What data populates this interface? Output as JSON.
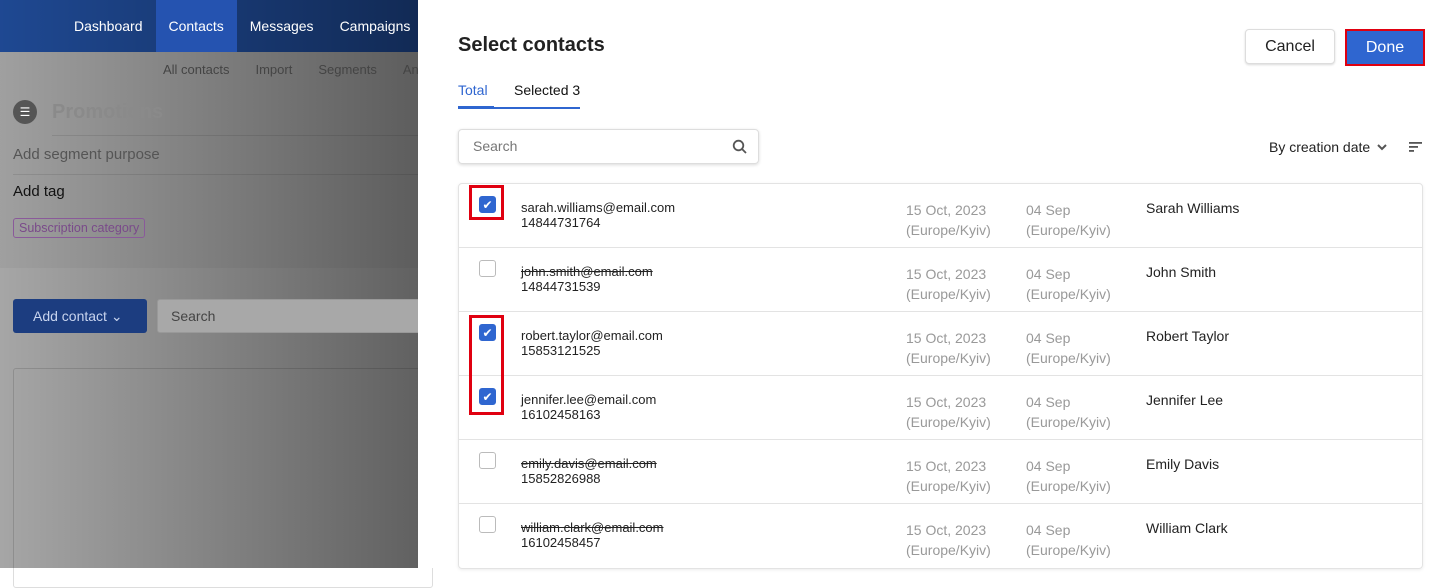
{
  "background": {
    "nav": [
      "Dashboard",
      "Contacts",
      "Messages",
      "Campaigns"
    ],
    "subnav": [
      "All contacts",
      "Import",
      "Segments",
      "Ana"
    ],
    "segment_title": "Promotions",
    "purpose": "Add segment purpose",
    "tag": "Add tag",
    "chip": "Subscription category",
    "add_contact": "Add contact",
    "search_placeholder": "Search"
  },
  "panel": {
    "title": "Select contacts",
    "cancel": "Cancel",
    "done": "Done",
    "tabs": [
      "Total",
      "Selected 3"
    ],
    "search_placeholder": "Search",
    "sort": "By creation date",
    "accent": "#2f66d0",
    "highlight": "#e00010",
    "rows": [
      {
        "email": "sarah.williams@email.com",
        "phone": "14844731764",
        "created": "15 Oct, 2023",
        "created_tz": "(Europe/Kyiv)",
        "date2": "04 Sep",
        "date2_tz": "(Europe/Kyiv)",
        "name": "Sarah Williams",
        "checked": true,
        "strike": false
      },
      {
        "email": "john.smith@email.com",
        "phone": "14844731539",
        "created": "15 Oct, 2023",
        "created_tz": "(Europe/Kyiv)",
        "date2": "04 Sep",
        "date2_tz": "(Europe/Kyiv)",
        "name": "John Smith",
        "checked": false,
        "strike": true
      },
      {
        "email": "robert.taylor@email.com",
        "phone": "15853121525",
        "created": "15 Oct, 2023",
        "created_tz": "(Europe/Kyiv)",
        "date2": "04 Sep",
        "date2_tz": "(Europe/Kyiv)",
        "name": "Robert Taylor",
        "checked": true,
        "strike": false
      },
      {
        "email": "jennifer.lee@email.com",
        "phone": "16102458163",
        "created": "15 Oct, 2023",
        "created_tz": "(Europe/Kyiv)",
        "date2": "04 Sep",
        "date2_tz": "(Europe/Kyiv)",
        "name": "Jennifer Lee",
        "checked": true,
        "strike": false
      },
      {
        "email": "emily.davis@email.com",
        "phone": "15852826988",
        "created": "15 Oct, 2023",
        "created_tz": "(Europe/Kyiv)",
        "date2": "04 Sep",
        "date2_tz": "(Europe/Kyiv)",
        "name": "Emily Davis",
        "checked": false,
        "strike": true
      },
      {
        "email": "william.clark@email.com",
        "phone": "16102458457",
        "created": "15 Oct, 2023",
        "created_tz": "(Europe/Kyiv)",
        "date2": "04 Sep",
        "date2_tz": "(Europe/Kyiv)",
        "name": "William Clark",
        "checked": false,
        "strike": true
      }
    ]
  }
}
